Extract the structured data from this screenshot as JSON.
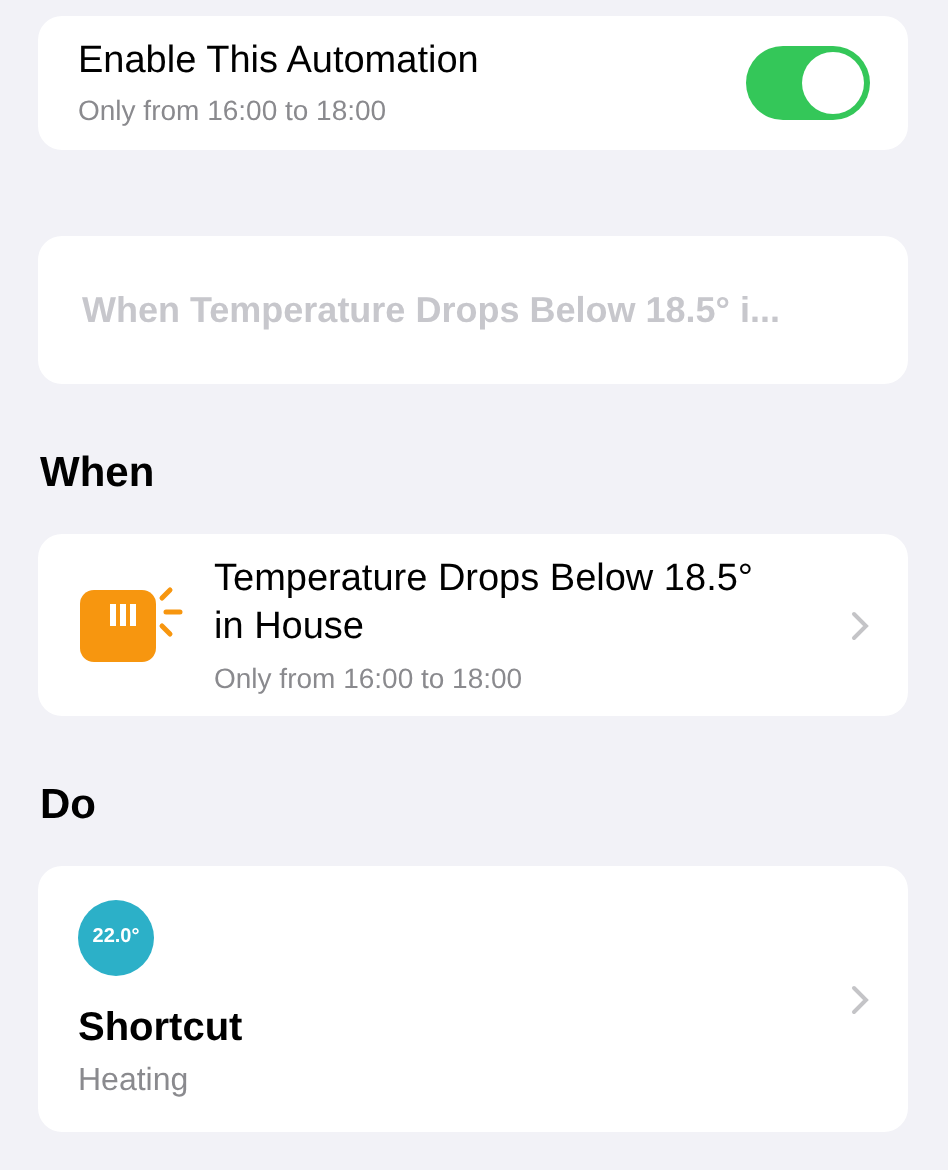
{
  "enable": {
    "title": "Enable This Automation",
    "subtitle": "Only from 16:00 to 18:00",
    "on": true
  },
  "name_field": {
    "placeholder": "When Temperature Drops Below 18.5° i..."
  },
  "sections": [
    {
      "header": "When",
      "item": {
        "kind": "trigger",
        "title_lines": [
          "Temperature Drops Below 18.5°",
          "in House"
        ],
        "subtitle": "Only from 16:00 to 18:00"
      }
    },
    {
      "header": "Do",
      "item": {
        "kind": "shortcut",
        "badge": "22.0°",
        "title": "Shortcut",
        "subtitle": "Heating"
      }
    }
  ]
}
